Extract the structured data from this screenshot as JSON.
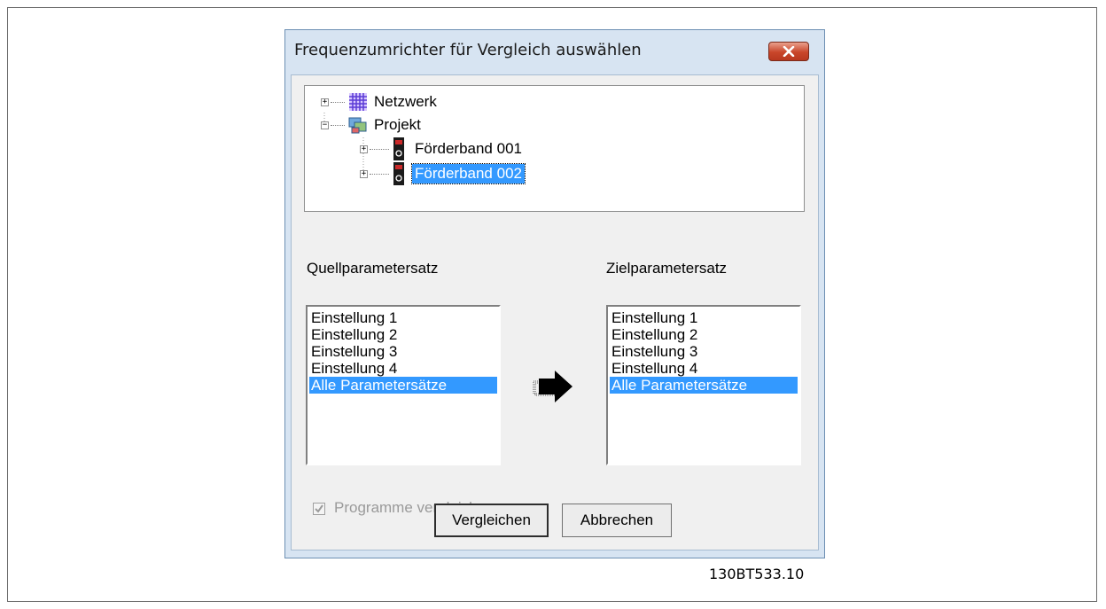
{
  "dialog": {
    "title": "Frequenzumrichter für Vergleich auswählen",
    "close_icon": "close-icon"
  },
  "tree": {
    "items": [
      {
        "label": "Netzwerk",
        "icon": "network-icon",
        "expanded": false
      },
      {
        "label": "Projekt",
        "icon": "project-icon",
        "expanded": true
      },
      {
        "label": "Förderband 001",
        "icon": "drive-icon",
        "expanded": false
      },
      {
        "label": "Förderband 002",
        "icon": "drive-icon",
        "expanded": false,
        "selected": true
      }
    ]
  },
  "source": {
    "label": "Quellparametersatz",
    "items": [
      "Einstellung 1",
      "Einstellung 2",
      "Einstellung 3",
      "Einstellung 4",
      "Alle Parametersätze"
    ],
    "selected": "Alle Parametersätze"
  },
  "target": {
    "label": "Zielparametersatz",
    "items": [
      "Einstellung 1",
      "Einstellung 2",
      "Einstellung 3",
      "Einstellung 4",
      "Alle Parametersätze"
    ],
    "selected": "Alle Parametersätze"
  },
  "arrow_icon": "copy-arrow-icon",
  "checkbox": {
    "label": "Programme vergleicl",
    "checked": true,
    "disabled": true
  },
  "buttons": {
    "compare": "Vergleichen",
    "cancel": "Abbrechen"
  },
  "figure_id": "130BT533.10"
}
